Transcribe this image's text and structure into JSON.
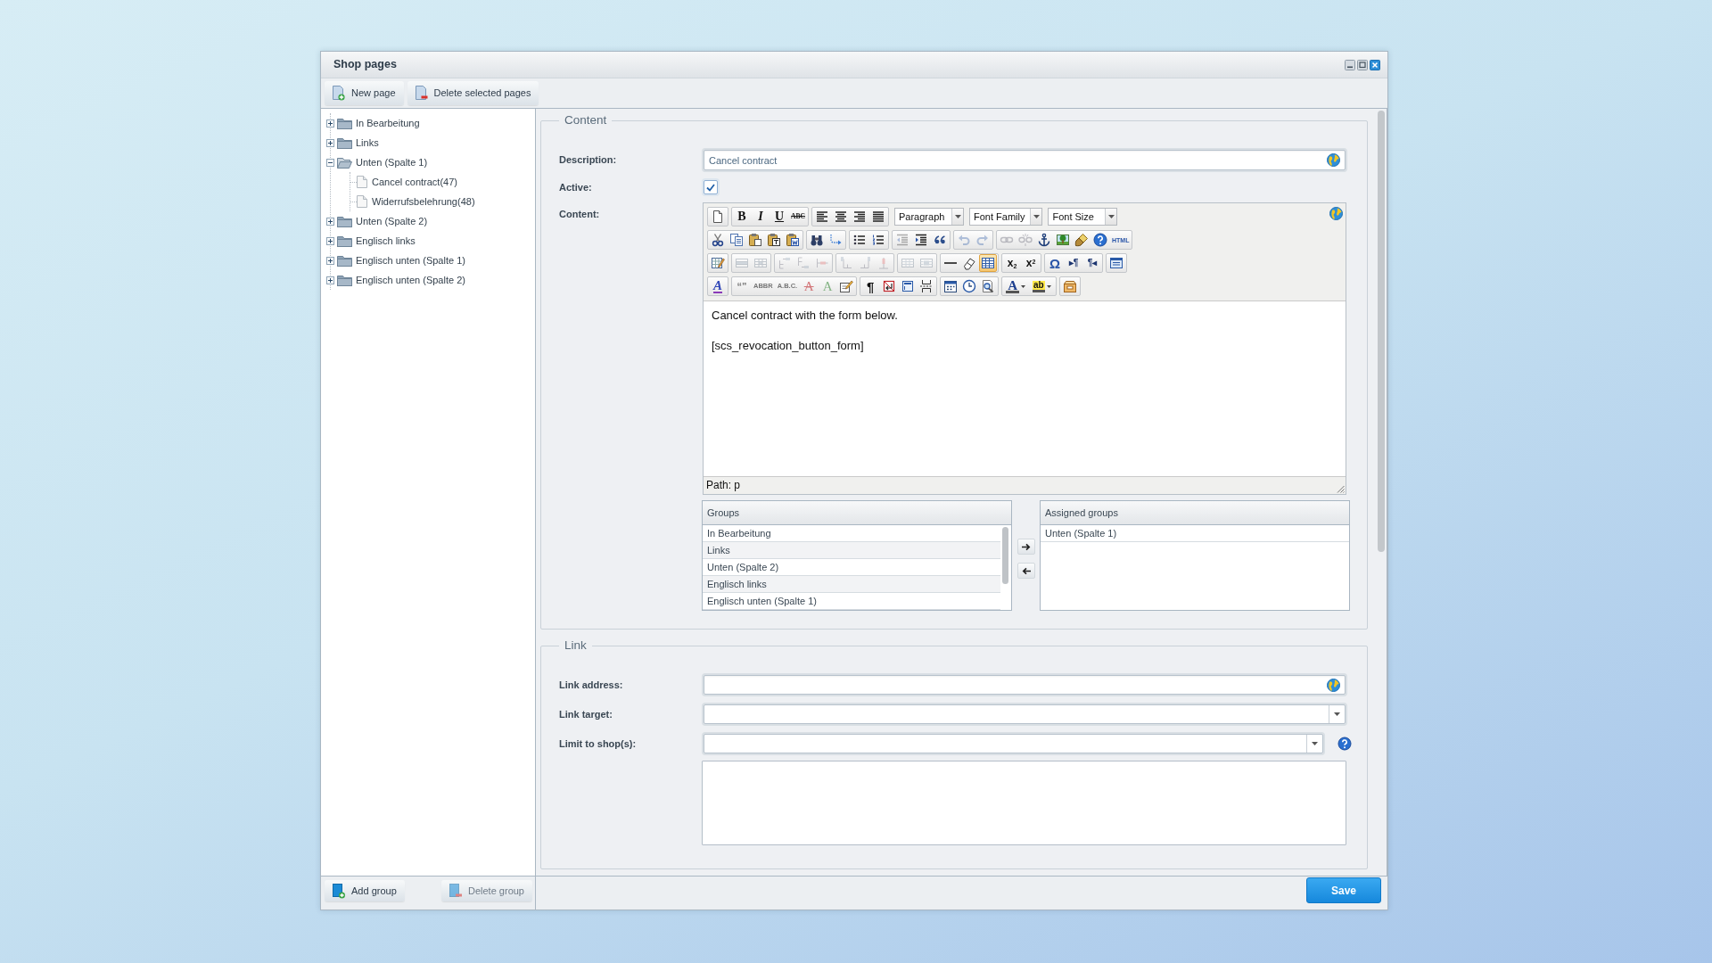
{
  "window": {
    "title": "Shop pages"
  },
  "toolbar": [
    {
      "label": "New page",
      "kind": "add"
    },
    {
      "label": "Delete selected pages",
      "kind": "delete"
    }
  ],
  "tree": [
    {
      "label": "In Bearbeitung",
      "kind": "folder",
      "expanded": false,
      "selected": false
    },
    {
      "label": "Links",
      "kind": "folder",
      "expanded": false,
      "selected": false
    },
    {
      "label": "Unten (Spalte 1)",
      "kind": "folder",
      "expanded": true,
      "selected": false,
      "children": [
        {
          "label": "Cancel contract(47)",
          "kind": "page",
          "selected": false
        },
        {
          "label": "Widerrufsbelehrung(48)",
          "kind": "page",
          "selected": false
        }
      ]
    },
    {
      "label": "Unten (Spalte 2)",
      "kind": "folder",
      "expanded": false,
      "selected": false
    },
    {
      "label": "Englisch links",
      "kind": "folder",
      "expanded": false,
      "selected": false
    },
    {
      "label": "Englisch unten (Spalte 1)",
      "kind": "folder",
      "expanded": false,
      "selected": false
    },
    {
      "label": "Englisch unten (Spalte 2)",
      "kind": "folder",
      "expanded": false,
      "selected": false
    }
  ],
  "content": {
    "legend": "Content",
    "description": {
      "label": "Description:",
      "value": "Cancel contract",
      "translatable": true
    },
    "active": {
      "label": "Active:",
      "checked": true
    },
    "editor": {
      "label": "Content:",
      "translatable": true,
      "toolbar": [
        [
          {
            "kind": "group",
            "buttons": [
              {
                "kind": "newdoc",
                "disabled": false,
                "active": false
              }
            ]
          },
          {
            "kind": "group",
            "buttons": [
              {
                "kind": "bold",
                "label": "B",
                "disabled": false,
                "active": false
              },
              {
                "kind": "italic",
                "label": "I",
                "disabled": false,
                "active": false
              },
              {
                "kind": "underline",
                "label": "U",
                "disabled": false,
                "active": false
              },
              {
                "kind": "strike",
                "label": "ABC",
                "disabled": false,
                "active": false
              }
            ]
          },
          {
            "kind": "group",
            "buttons": [
              {
                "kind": "alignleft",
                "disabled": false,
                "active": false
              },
              {
                "kind": "aligncenter",
                "disabled": false,
                "active": false
              },
              {
                "kind": "alignright",
                "disabled": false,
                "active": false
              },
              {
                "kind": "justify",
                "disabled": false,
                "active": false
              }
            ]
          },
          {
            "kind": "select",
            "value": "Paragraph"
          },
          {
            "kind": "select",
            "value": "Font Family"
          },
          {
            "kind": "select",
            "value": "Font Size"
          }
        ],
        [
          {
            "kind": "group",
            "buttons": [
              {
                "kind": "cut",
                "disabled": false,
                "active": false
              },
              {
                "kind": "copy",
                "disabled": false,
                "active": false
              },
              {
                "kind": "paste",
                "disabled": false,
                "active": false
              },
              {
                "kind": "pastetext",
                "disabled": false,
                "active": false
              },
              {
                "kind": "pasteword",
                "disabled": false,
                "active": false
              }
            ]
          },
          {
            "kind": "group",
            "buttons": [
              {
                "kind": "find",
                "disabled": false,
                "active": false
              },
              {
                "kind": "replace",
                "disabled": false,
                "active": false
              }
            ]
          },
          {
            "kind": "group",
            "buttons": [
              {
                "kind": "bullist",
                "disabled": false,
                "active": false
              },
              {
                "kind": "numlist",
                "disabled": false,
                "active": false
              }
            ]
          },
          {
            "kind": "group",
            "buttons": [
              {
                "kind": "outdent",
                "disabled": true,
                "active": false
              },
              {
                "kind": "indent",
                "disabled": false,
                "active": false
              },
              {
                "kind": "blockquote",
                "disabled": false,
                "active": false
              }
            ]
          },
          {
            "kind": "group",
            "buttons": [
              {
                "kind": "undo",
                "disabled": true,
                "active": false
              },
              {
                "kind": "redo",
                "disabled": true,
                "active": false
              }
            ]
          },
          {
            "kind": "group",
            "buttons": [
              {
                "kind": "link",
                "disabled": true,
                "active": false
              },
              {
                "kind": "unlink",
                "disabled": true,
                "active": false
              },
              {
                "kind": "anchor",
                "disabled": false,
                "active": false
              },
              {
                "kind": "image",
                "disabled": false,
                "active": false
              },
              {
                "kind": "cleanup",
                "disabled": false,
                "active": false
              },
              {
                "kind": "help",
                "disabled": false,
                "active": false
              },
              {
                "kind": "html",
                "label": "HTML",
                "disabled": false,
                "active": false
              }
            ]
          }
        ],
        [
          {
            "kind": "group",
            "buttons": [
              {
                "kind": "table",
                "disabled": false,
                "active": false
              }
            ]
          },
          {
            "kind": "group",
            "buttons": [
              {
                "kind": "rowprops",
                "disabled": true,
                "active": false
              },
              {
                "kind": "cellprops",
                "disabled": true,
                "active": false
              }
            ]
          },
          {
            "kind": "group",
            "buttons": [
              {
                "kind": "rowbefore",
                "disabled": true,
                "active": false
              },
              {
                "kind": "rowafter",
                "disabled": true,
                "active": false
              },
              {
                "kind": "deleterow",
                "disabled": true,
                "active": false
              }
            ]
          },
          {
            "kind": "group",
            "buttons": [
              {
                "kind": "colbefore",
                "disabled": true,
                "active": false
              },
              {
                "kind": "colafter",
                "disabled": true,
                "active": false
              },
              {
                "kind": "deletecol",
                "disabled": true,
                "active": false
              }
            ]
          },
          {
            "kind": "group",
            "buttons": [
              {
                "kind": "splitcells",
                "disabled": true,
                "active": false
              },
              {
                "kind": "mergecells",
                "disabled": true,
                "active": false
              }
            ]
          },
          {
            "kind": "group",
            "buttons": [
              {
                "kind": "hr",
                "disabled": false,
                "active": false
              },
              {
                "kind": "removeformat",
                "disabled": false,
                "active": false
              },
              {
                "kind": "visualaid",
                "disabled": false,
                "active": true
              }
            ]
          },
          {
            "kind": "group",
            "buttons": [
              {
                "kind": "sub",
                "label": "x$_{2}$",
                "disabled": false,
                "active": false
              },
              {
                "kind": "sup",
                "label": "x$^{2}$",
                "disabled": false,
                "active": false
              }
            ]
          },
          {
            "kind": "group",
            "buttons": [
              {
                "kind": "charmap",
                "label": "Ω",
                "disabled": false,
                "active": false
              },
              {
                "kind": "ltr",
                "label": "▸¶",
                "disabled": false,
                "active": false
              },
              {
                "kind": "rtl",
                "label": "¶◂",
                "disabled": false,
                "active": false
              }
            ]
          },
          {
            "kind": "group",
            "buttons": [
              {
                "kind": "fullscreen",
                "disabled": false,
                "active": false
              }
            ]
          }
        ],
        [
          {
            "kind": "group",
            "buttons": [
              {
                "kind": "styleprops",
                "label": "A",
                "disabled": false,
                "active": false
              }
            ]
          },
          {
            "kind": "group",
            "buttons": [
              {
                "kind": "cite",
                "label": "“”",
                "disabled": true,
                "active": false
              },
              {
                "kind": "abbr",
                "label": "ABBR",
                "disabled": true,
                "active": false
              },
              {
                "kind": "acronym",
                "label": "A.B.C.",
                "disabled": true,
                "active": false
              },
              {
                "kind": "del",
                "label": "A",
                "disabled": true,
                "active": false
              },
              {
                "kind": "ins",
                "label": "A",
                "disabled": true,
                "active": false
              },
              {
                "kind": "attribs",
                "disabled": false,
                "active": false
              }
            ]
          },
          {
            "kind": "group",
            "buttons": [
              {
                "kind": "visualchars",
                "label": "¶",
                "disabled": false,
                "active": false
              },
              {
                "kind": "nonbreaking",
                "disabled": false,
                "active": false
              },
              {
                "kind": "layer",
                "disabled": false,
                "active": false
              },
              {
                "kind": "pagebreak",
                "disabled": false,
                "active": false
              }
            ]
          },
          {
            "kind": "group",
            "buttons": [
              {
                "kind": "date",
                "disabled": false,
                "active": false
              },
              {
                "kind": "time",
                "disabled": false,
                "active": false
              },
              {
                "kind": "preview",
                "disabled": false,
                "active": false
              }
            ]
          },
          {
            "kind": "group",
            "buttons": [
              {
                "kind": "forecolor",
                "label": "A",
                "disabled": false,
                "active": false
              },
              {
                "kind": "backcolor",
                "label": "ab",
                "disabled": false,
                "active": false
              }
            ]
          },
          {
            "kind": "group",
            "buttons": [
              {
                "kind": "template",
                "disabled": false,
                "active": false
              }
            ]
          }
        ]
      ],
      "paragraphs": [
        "Cancel contract with the form below.",
        "[scs_revocation_button_form]"
      ],
      "path": "Path: p"
    },
    "groups": {
      "title": "Groups",
      "items": [
        {
          "label": "In Bearbeitung",
          "selected": false
        },
        {
          "label": "Links",
          "selected": false
        },
        {
          "label": "Unten (Spalte 2)",
          "selected": false
        },
        {
          "label": "Englisch links",
          "selected": false
        },
        {
          "label": "Englisch unten (Spalte 1)",
          "selected": false
        }
      ]
    },
    "assigned_groups": {
      "title": "Assigned groups",
      "items": [
        {
          "label": "Unten (Spalte 1)",
          "selected": false
        }
      ]
    }
  },
  "link": {
    "legend": "Link",
    "fields": [
      {
        "kind": "text",
        "label": "Link address:",
        "translatable": true
      },
      {
        "kind": "select",
        "label": "Link target:"
      },
      {
        "kind": "select",
        "label": "Limit to shop(s):",
        "help": true
      },
      {
        "kind": "textarea"
      }
    ]
  },
  "bottom_bar": {
    "buttons": [
      {
        "label": "Add group",
        "kind": "add",
        "disabled": false
      },
      {
        "label": "Delete group",
        "kind": "delete",
        "disabled": true
      }
    ],
    "save": "Save"
  }
}
